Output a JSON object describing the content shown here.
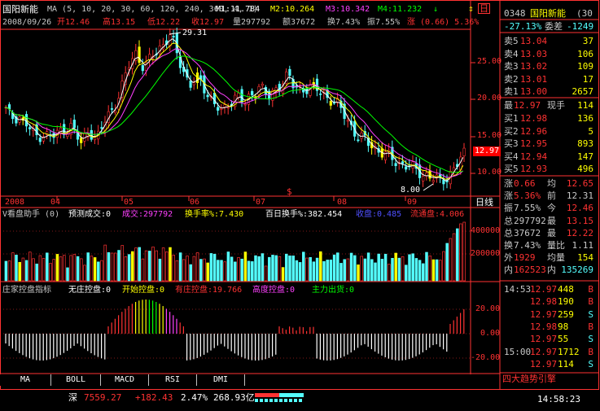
{
  "header": {
    "stock_name": "国阳新能",
    "ma_label": "MA (5, 10, 20, 30, 60, 120, 240, 360, 4, 1)",
    "m1": "M1:11.784",
    "m2": "M2:10.264",
    "m3": "M3:10.342",
    "m4": "M4:11.232",
    "m4_arrow": "↓",
    "date": "2008/09/26",
    "open": "开12.46",
    "high": "高13.15",
    "low": "低12.22",
    "close": "收12.97",
    "volume": "量297792",
    "amount": "额37672",
    "turnover": "换7.43%",
    "amplitude": "振7.55%",
    "change": "涨 (0.66) 5.36%"
  },
  "price_panel": {
    "y_ticks": [
      "25.00",
      "20.00",
      "15.00",
      "10.00"
    ],
    "current_price": "12.97",
    "high_marker": "29.31",
    "low_marker": "8.00",
    "signal_mark": "$"
  },
  "date_axis": [
    "2008",
    "04",
    "05",
    "06",
    "07",
    "08",
    "09"
  ],
  "date_axis_right": "日线",
  "volume_panel": {
    "title": "V看盘助手 (0)",
    "forecast": "预测成交:0",
    "volume": "成交:297792",
    "turnover_rate": "换手率%:7.430",
    "turnover_100d": "百日换手%:382.454",
    "profit_chips": "收盘:0.485",
    "float_chips": "流通盘:4.006",
    "y_ticks": [
      "400000",
      "200000"
    ],
    "bars_color_up": "#ff3232",
    "bars_color_down": "#54ffff",
    "bars_color_gold": "#ffff00"
  },
  "dealer_panel": {
    "title": "庄家控盘指标",
    "no_control": "无庄控盘:0",
    "start_control": "开始控盘:0",
    "has_control": "有庄控盘:19.766",
    "high_control": "高度控盘:0",
    "main_exit": "主力出货:0",
    "y_ticks": [
      "20.00",
      "0.00",
      "-20.00"
    ]
  },
  "tabs": [
    "MA",
    "BOLL",
    "MACD",
    "RSI",
    "DMI"
  ],
  "status_bar": {
    "market": "深",
    "index": "7559.27",
    "change": "+182.43",
    "pct": "2.47%",
    "turnover": "268.93亿",
    "time": "14:58:23"
  },
  "quote": {
    "code": "0348",
    "name": "国阳新能",
    "ratio_label": "委比",
    "ratio_pct": "-27.13%",
    "ratio_diff": "委差",
    "ratio_diff_val": "-1249",
    "sells": [
      {
        "label": "卖5",
        "price": "13.04",
        "vol": "37"
      },
      {
        "label": "卖4",
        "price": "13.03",
        "vol": "106"
      },
      {
        "label": "卖3",
        "price": "13.02",
        "vol": "109"
      },
      {
        "label": "卖2",
        "price": "13.01",
        "vol": "17"
      },
      {
        "label": "卖1",
        "price": "13.00",
        "vol": "2657"
      }
    ],
    "last": {
      "label": "最",
      "price": "12.97",
      "label2": "现手",
      "vol": "114"
    },
    "buys": [
      {
        "label": "买1",
        "price": "12.98",
        "vol": "136"
      },
      {
        "label": "买2",
        "price": "12.96",
        "vol": "5"
      },
      {
        "label": "买3",
        "price": "12.95",
        "vol": "893"
      },
      {
        "label": "买4",
        "price": "12.94",
        "vol": "147"
      },
      {
        "label": "买5",
        "price": "12.93",
        "vol": "496"
      }
    ],
    "stats": [
      {
        "a": "涨",
        "b": "0.66",
        "c": "均",
        "d": "12.65"
      },
      {
        "a": "涨",
        "b": "5.36%",
        "c": "前",
        "d": "12.31"
      },
      {
        "a": "振",
        "b": "7.55%",
        "c": "今",
        "d": "12.46"
      },
      {
        "a": "总",
        "b": "297792",
        "c": "最",
        "d": "13.15"
      },
      {
        "a": "总",
        "b": "37672",
        "c": "最",
        "d": "12.22"
      },
      {
        "a": "换",
        "b": "7.43%",
        "c": "量比",
        "d": "1.11"
      },
      {
        "a": "外",
        "b": "1929",
        "c": "均量",
        "d": "154"
      },
      {
        "a": "内",
        "b": "162523",
        "c": "内",
        "d": "135269"
      }
    ],
    "ticks": [
      {
        "time": "14:53",
        "price": "12.97",
        "vol": "448",
        "side": "B"
      },
      {
        "time": "",
        "price": "12.98",
        "vol": "190",
        "side": "B"
      },
      {
        "time": "",
        "price": "12.97",
        "vol": "259",
        "side": "S"
      },
      {
        "time": "",
        "price": "12.98",
        "vol": "98",
        "side": "B"
      },
      {
        "time": "",
        "price": "12.97",
        "vol": "55",
        "side": "S"
      },
      {
        "time": "15:00",
        "price": "12.97",
        "vol": "1712",
        "side": "B"
      },
      {
        "time": "",
        "price": "12.97",
        "vol": "114",
        "side": "S"
      }
    ],
    "footer": "四大趋势引擎"
  }
}
